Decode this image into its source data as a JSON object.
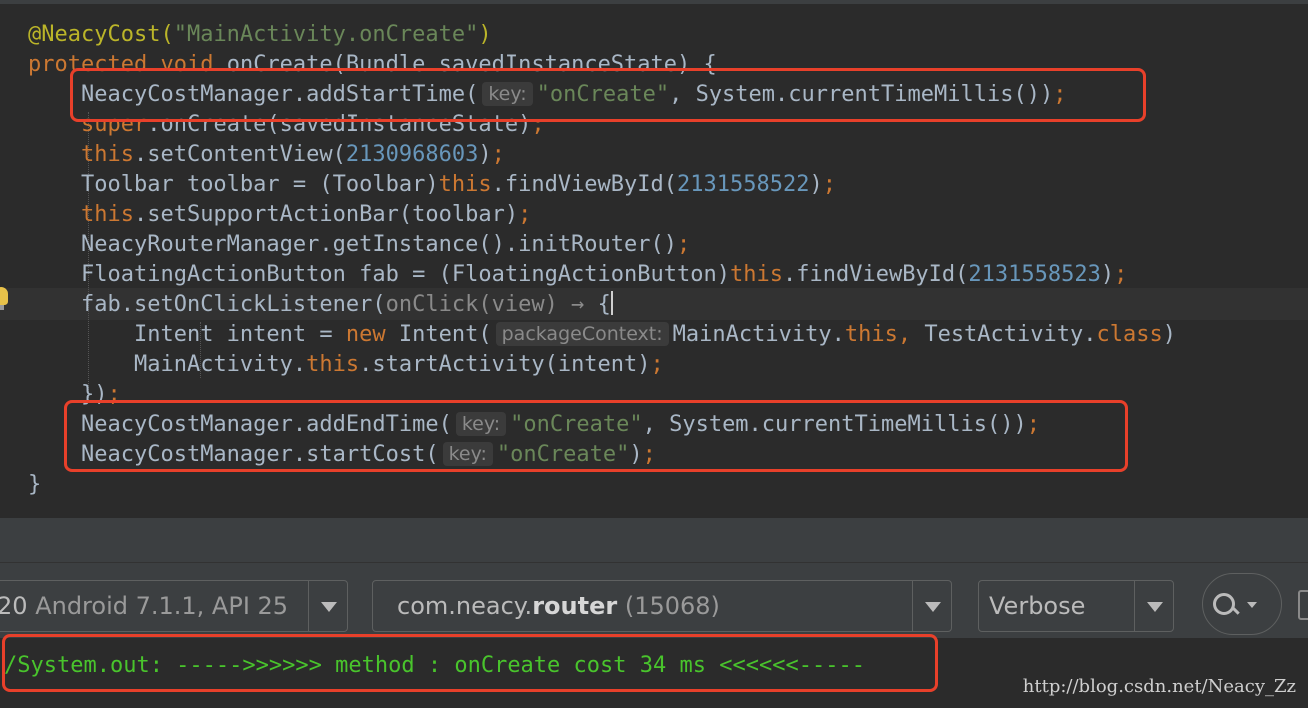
{
  "editor": {
    "lines": {
      "l1": {
        "annotation": "@NeacyCost(",
        "str": "\"MainActivity.onCreate\"",
        "close": ")"
      },
      "l2": {
        "kw1": "protected",
        "kw2": "void",
        "rest": "onCreate(Bundle savedInstanceState) {"
      },
      "l3": {
        "pre": "NeacyCostManager.addStartTime(",
        "hint": "key:",
        "str": "\"onCreate\"",
        "post": ", System.currentTimeMillis())",
        "semi": ";"
      },
      "l4": {
        "kw": "super",
        "rest": ".onCreate(savedInstanceState)",
        "semi": ";"
      },
      "l5": {
        "kw": "this",
        "mid": ".setContentView(",
        "num": "2130968603",
        "close": ")",
        "semi": ";"
      },
      "l6": {
        "pre": "Toolbar toolbar = (Toolbar)",
        "kw": "this",
        "mid": ".findViewById(",
        "num": "2131558522",
        "close": ")",
        "semi": ";"
      },
      "l7": {
        "kw": "this",
        "rest": ".setSupportActionBar(toolbar)",
        "semi": ";"
      },
      "l8": {
        "text": "NeacyRouterManager.getInstance().initRouter()",
        "semi": ";"
      },
      "l9": {
        "pre": "FloatingActionButton fab = (FloatingActionButton)",
        "kw": "this",
        "mid": ".findViewById(",
        "num": "2131558523",
        "close": ")",
        "semi": ";"
      },
      "l10": {
        "pre": "fab.setOnClickListener(",
        "fold": "onClick(view) →",
        "brace": "{"
      },
      "l11": {
        "pre": "Intent intent = ",
        "kw": "new",
        "mid": " Intent(",
        "hint": "packageContext:",
        "a": "MainActivity.",
        "kw2": "this",
        "comma": ",",
        "b": " TestActivity.",
        "kw3": "class",
        "close": ")"
      },
      "l12": {
        "a": "MainActivity.",
        "kw": "this",
        "rest": ".startActivity(intent)",
        "semi": ";"
      },
      "l13": {
        "text": "})",
        "semi": ";"
      },
      "l14": {
        "pre": "NeacyCostManager.addEndTime(",
        "hint": "key:",
        "str": "\"onCreate\"",
        "post": ", System.currentTimeMillis())",
        "semi": ";"
      },
      "l15": {
        "pre": "NeacyCostManager.startCost(",
        "hint": "key:",
        "str": "\"onCreate\"",
        "close": ")",
        "semi": ";"
      },
      "l16": {
        "text": "}"
      }
    }
  },
  "logcat": {
    "device": {
      "prefix": "20",
      "label": "Android 7.1.1, API 25"
    },
    "process": {
      "pkg_prefix": "com.neacy.",
      "pkg_bold": "router",
      "pid": "(15068)"
    },
    "level": "Verbose",
    "output_line": "/System.out: ----->>>>>> method : onCreate cost 34 ms <<<<<<-----"
  },
  "watermark": "http://blog.csdn.net/Neacy_Zz",
  "colors": {
    "keyword": "#cc7832",
    "string": "#6a8759",
    "number": "#6897bb",
    "annotation": "#bbb529",
    "highlight_box": "#e8402a",
    "log_text": "#49c42c"
  },
  "icons": [
    "lightbulb-icon",
    "chevron-down-icon",
    "search-icon"
  ]
}
